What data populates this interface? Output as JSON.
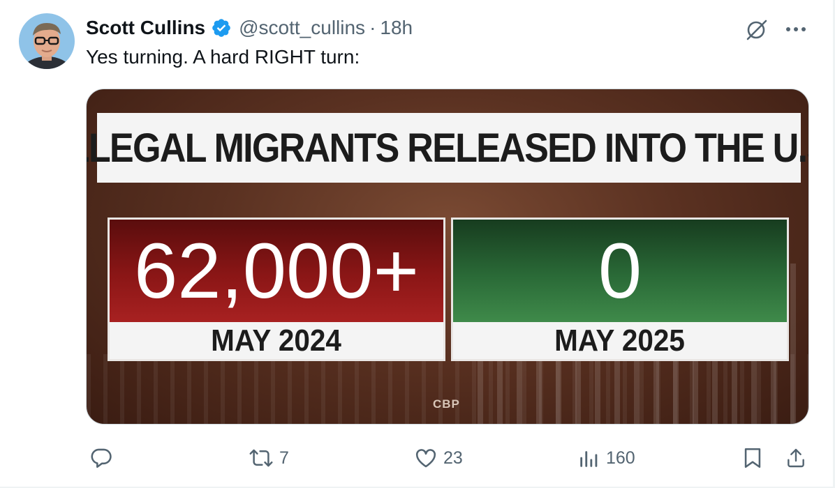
{
  "tweet": {
    "author": {
      "display_name": "Scott Cullins",
      "handle": "@scott_cullins",
      "verified": true
    },
    "separator": "·",
    "timestamp": "18h",
    "text": "Yes turning. A hard RIGHT turn:"
  },
  "media": {
    "headline": "ILLEGAL MIGRANTS RELEASED INTO THE U.S.",
    "panels": [
      {
        "value": "62,000+",
        "label": "MAY 2024",
        "color": "#8b1616"
      },
      {
        "value": "0",
        "label": "MAY 2025",
        "color": "#2a6a37"
      }
    ],
    "source": "CBP"
  },
  "actions": {
    "reply": {
      "icon": "reply-icon",
      "count": ""
    },
    "retweet": {
      "icon": "retweet-icon",
      "count": "7"
    },
    "like": {
      "icon": "heart-icon",
      "count": "23"
    },
    "views": {
      "icon": "views-icon",
      "count": "160"
    },
    "bookmark": {
      "icon": "bookmark-icon"
    },
    "share": {
      "icon": "share-icon"
    }
  },
  "colors": {
    "text_primary": "#0f1419",
    "text_secondary": "#536471",
    "verified_blue": "#1d9bf0"
  }
}
